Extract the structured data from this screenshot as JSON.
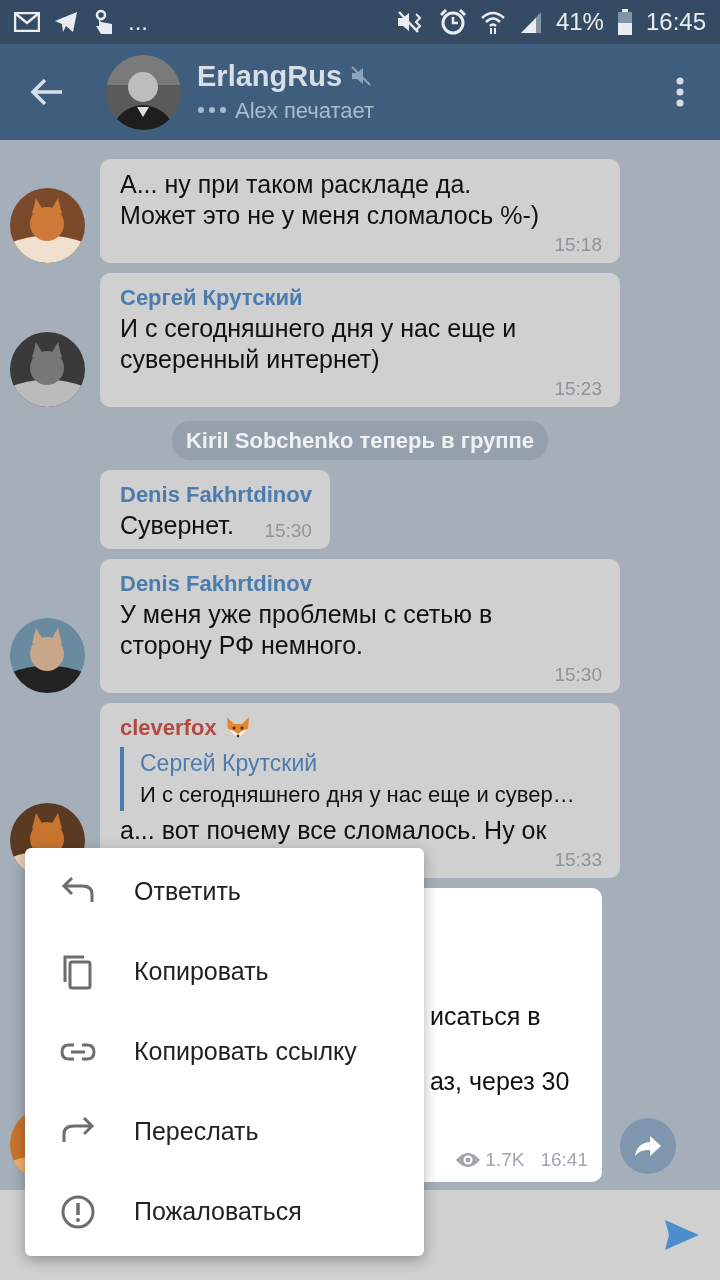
{
  "status_bar": {
    "more": "...",
    "battery": "41%",
    "time": "16:45"
  },
  "header": {
    "title": "ErlangRus",
    "muted": true,
    "subtitle": "Alex печатает"
  },
  "messages": [
    {
      "kind": "message",
      "avatar": true,
      "selected": false,
      "text": "А... ну при таком раскладе да. Может это не у меня сломалось %-)",
      "time": "15:18"
    },
    {
      "kind": "message",
      "avatar": true,
      "selected": false,
      "sender": "Сергей Крутский",
      "color": "#4a7cb0",
      "text": "И с сегодняшнего дня у нас еще и суверенный интернет)",
      "time": "15:23"
    },
    {
      "kind": "service",
      "text": "Kiril Sobchenko теперь в группе"
    },
    {
      "kind": "message",
      "avatar": false,
      "selected": false,
      "sender": "Denis Fakhrtdinov",
      "color": "#4a7cb0",
      "text": "Сувернет.",
      "time": "15:30"
    },
    {
      "kind": "message",
      "avatar": true,
      "selected": false,
      "sender": "Denis Fakhrtdinov",
      "color": "#4a7cb0",
      "text": "У меня уже проблемы с сетью в сторону РФ немного.",
      "time": "15:30"
    },
    {
      "kind": "message",
      "avatar": true,
      "selected": false,
      "sender": "cleverfox",
      "color": "#b4493f",
      "emoji_badge": true,
      "reply": {
        "sender": "Сергей Крутский",
        "text": "И с сегодняшнего дня у нас еще и сувер…"
      },
      "text": "а... вот почему все сломалось. Ну ок",
      "time": "15:33"
    },
    {
      "kind": "partial",
      "avatar": true,
      "selected": true,
      "lines": [
        "исаться в",
        "аз, через 30"
      ],
      "views": "1.7K",
      "time": "16:41",
      "share": true
    }
  ],
  "menu": [
    "Ответить",
    "Копировать",
    "Копировать ссылку",
    "Переслать",
    "Пожаловаться"
  ]
}
